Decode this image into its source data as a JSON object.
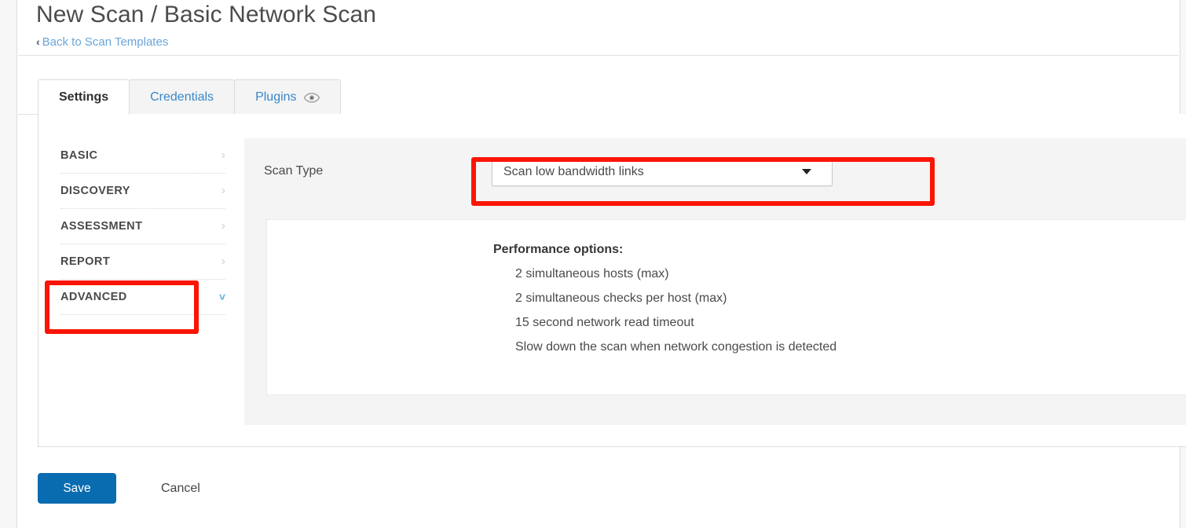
{
  "header": {
    "title": "New Scan / Basic Network Scan",
    "breadcrumb_chevron": "‹",
    "breadcrumb_label": "Back to Scan Templates"
  },
  "tabs": [
    {
      "label": "Settings",
      "active": true,
      "icon": null
    },
    {
      "label": "Credentials",
      "active": false,
      "icon": null
    },
    {
      "label": "Plugins",
      "active": false,
      "icon": "eye-icon"
    }
  ],
  "sidebar": {
    "items": [
      {
        "label": "BASIC",
        "chevron": "›",
        "expanded": false
      },
      {
        "label": "DISCOVERY",
        "chevron": "›",
        "expanded": false
      },
      {
        "label": "ASSESSMENT",
        "chevron": "›",
        "expanded": false
      },
      {
        "label": "REPORT",
        "chevron": "›",
        "expanded": false
      },
      {
        "label": "ADVANCED",
        "chevron": "˅",
        "expanded": true
      }
    ]
  },
  "content": {
    "scan_type_label": "Scan Type",
    "scan_type_value": "Scan low bandwidth links",
    "performance_title": "Performance options:",
    "performance_options": [
      "2 simultaneous hosts (max)",
      "2 simultaneous checks per host (max)",
      "15 second network read timeout",
      "Slow down the scan when network congestion is detected"
    ]
  },
  "footer": {
    "save_label": "Save",
    "cancel_label": "Cancel"
  },
  "colors": {
    "accent_blue": "#0a6cb0",
    "link_blue": "#3a87c8",
    "annotation_red": "#fa1505",
    "expanded_chevron": "#4fb3d9",
    "panel_gray": "#f4f4f4"
  }
}
